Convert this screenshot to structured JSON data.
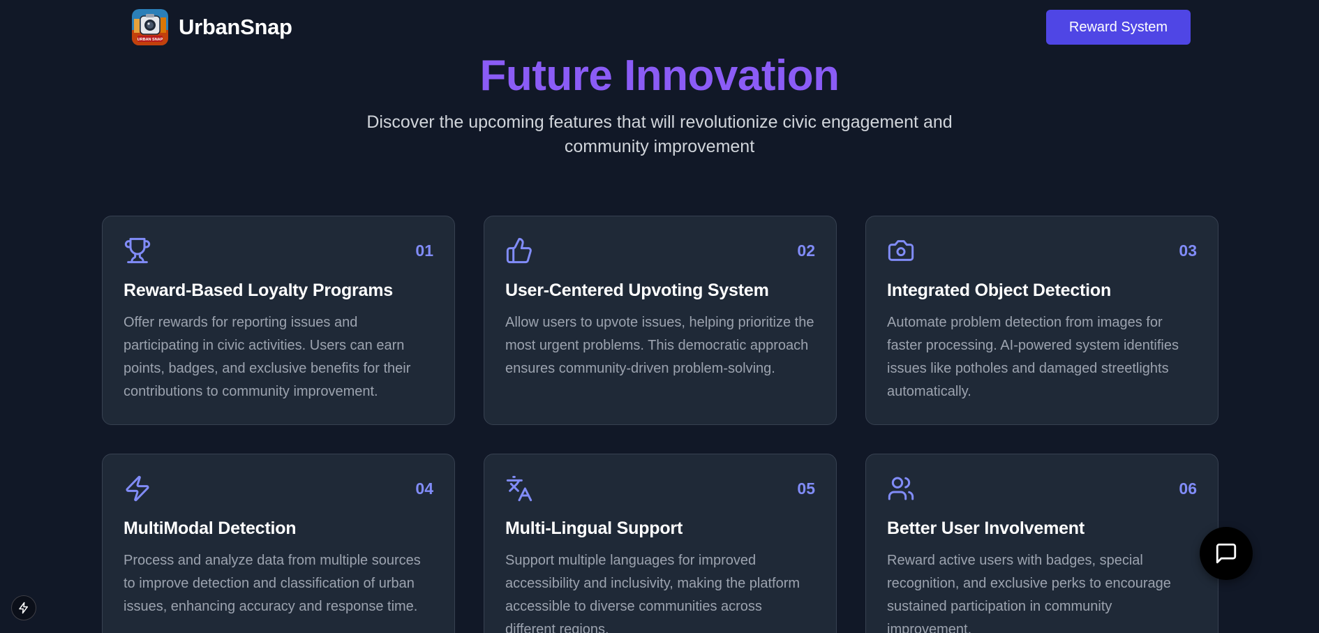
{
  "header": {
    "brand_name": "UrbanSnap",
    "logo_text": "URBAN SNAP",
    "cta_label": "Reward System",
    "accent_color": "#4f46e5"
  },
  "hero": {
    "title": "Future Innovation",
    "subtitle": "Discover the upcoming features that will revolutionize civic engagement and community improvement",
    "title_color": "#8b5cf6"
  },
  "features": [
    {
      "number": "01",
      "icon": "trophy-icon",
      "title": "Reward-Based Loyalty Programs",
      "description": "Offer rewards for reporting issues and participating in civic activities. Users can earn points, badges, and exclusive benefits for their contributions to community improvement."
    },
    {
      "number": "02",
      "icon": "thumbs-up-icon",
      "title": "User-Centered Upvoting System",
      "description": "Allow users to upvote issues, helping prioritize the most urgent problems. This democratic approach ensures community-driven problem-solving."
    },
    {
      "number": "03",
      "icon": "camera-icon",
      "title": "Integrated Object Detection",
      "description": "Automate problem detection from images for faster processing. AI-powered system identifies issues like potholes and damaged streetlights automatically."
    },
    {
      "number": "04",
      "icon": "lightning-icon",
      "title": "MultiModal Detection",
      "description": "Process and analyze data from multiple sources to improve detection and classification of urban issues, enhancing accuracy and response time."
    },
    {
      "number": "05",
      "icon": "translate-icon",
      "title": "Multi-Lingual Support",
      "description": "Support multiple languages for improved accessibility and inclusivity, making the platform accessible to diverse communities across different regions."
    },
    {
      "number": "06",
      "icon": "users-icon",
      "title": "Better User Involvement",
      "description": "Reward active users with badges, special recognition, and exclusive perks to encourage sustained participation in community improvement."
    }
  ],
  "widgets": {
    "chat_icon": "chat-bubble-icon",
    "badge_icon": "lightning-icon"
  },
  "colors": {
    "background": "#111827",
    "card": "#1f2937",
    "card_border": "#374151",
    "number": "#818cf8",
    "icon": "#818cf8"
  }
}
